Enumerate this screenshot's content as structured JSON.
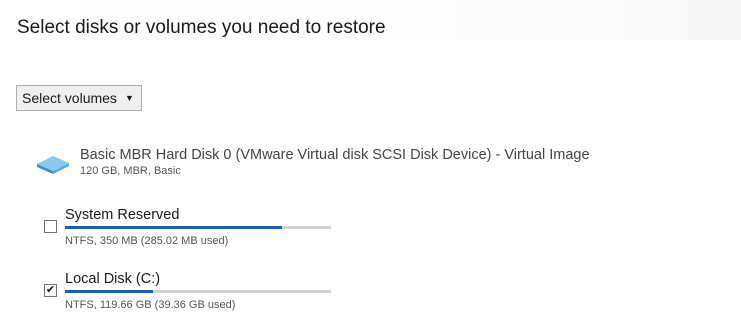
{
  "header": {
    "title": "Select disks or volumes you need to restore"
  },
  "selector": {
    "label": "Select volumes",
    "arrow": "▼"
  },
  "disk": {
    "icon": "hard-disk-icon",
    "name": "Basic MBR Hard Disk 0 (VMware Virtual disk SCSI Disk Device) - Virtual Image",
    "details": "120 GB, MBR, Basic"
  },
  "volumes": [
    {
      "name": "System Reserved",
      "details": "NTFS, 350 MB (285.02 MB used)",
      "checked": false,
      "used_fraction": 0.814
    },
    {
      "name": "Local Disk (C:)",
      "details": "NTFS, 119.66 GB (39.36 GB used)",
      "checked": true,
      "check_glyph": "✔",
      "used_fraction": 0.329
    }
  ],
  "colors": {
    "usage_fill": "#1f5fbf",
    "usage_track": "#d2d2d2",
    "disk_icon": "#5aa9e6"
  }
}
